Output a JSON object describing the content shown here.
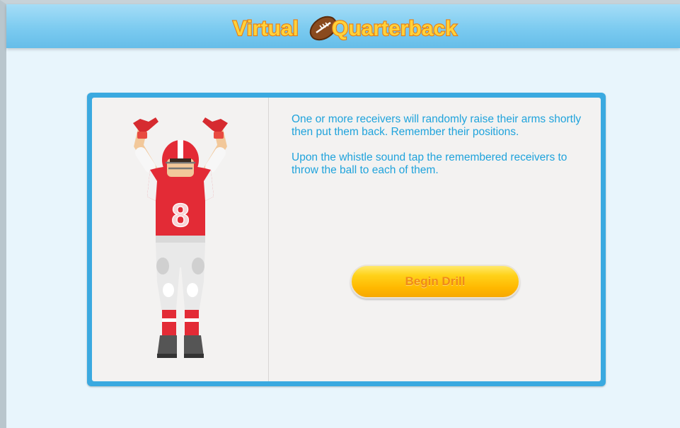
{
  "header": {
    "app_title_part1": "Virtual",
    "app_title_part2": "Quarterback"
  },
  "instructions": {
    "paragraph1": "One or more receivers will randomly raise their arms shortly then put them back. Remember their positions.",
    "paragraph2": "Upon the whistle sound tap the remembered receivers to throw the ball to each of them."
  },
  "player": {
    "jersey_number": "8"
  },
  "actions": {
    "begin_label": "Begin Drill"
  },
  "colors": {
    "header_blue": "#7ccbf0",
    "panel_border": "#3aa9e0",
    "text_blue": "#1fa3dc",
    "button_yellow": "#ffc400",
    "button_text": "#f08a1a",
    "jersey_red": "#e32b36"
  }
}
